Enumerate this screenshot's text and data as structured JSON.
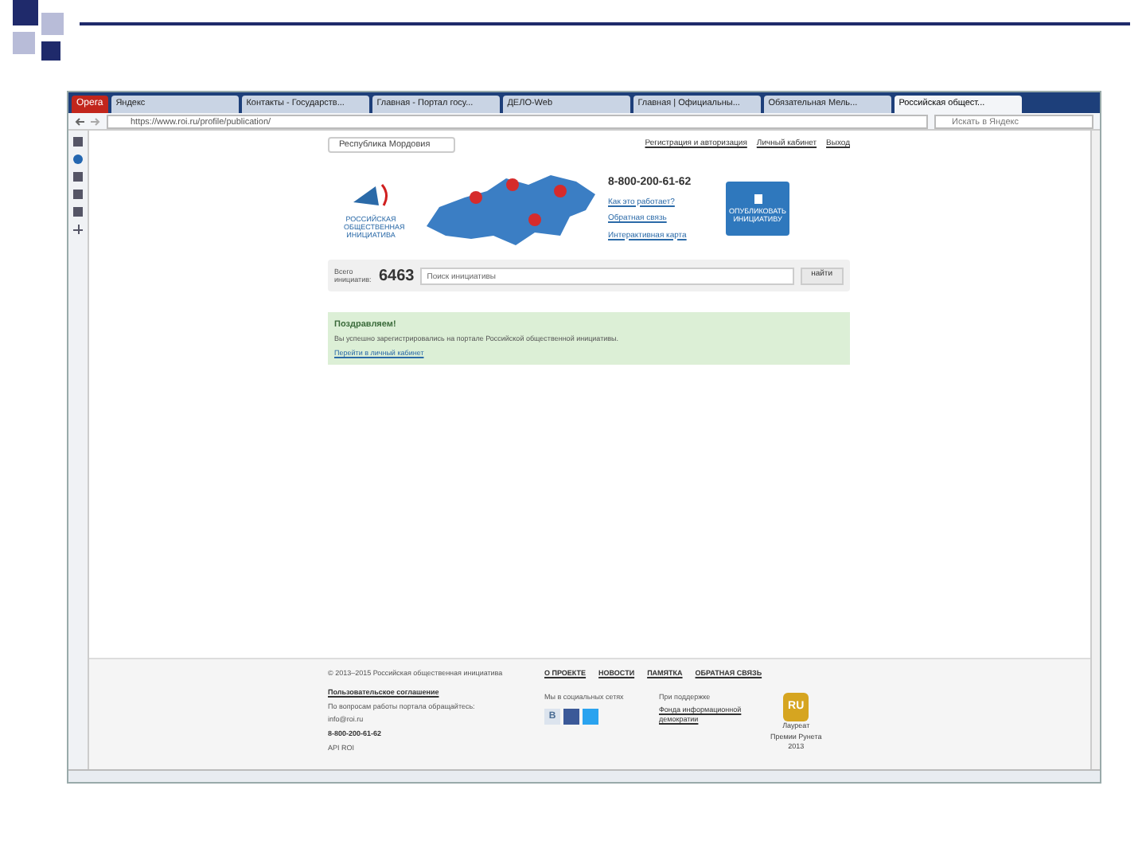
{
  "browser": {
    "menu_button": "Opera",
    "tabs": [
      {
        "label": "Яндекс",
        "selected": false
      },
      {
        "label": "Контакты - Государств...",
        "selected": false
      },
      {
        "label": "Главная - Портал госу...",
        "selected": false
      },
      {
        "label": "ДЕЛО-Web",
        "selected": false
      },
      {
        "label": "Главная | Официальны...",
        "selected": false
      },
      {
        "label": "Обязательная Мель...",
        "selected": false
      },
      {
        "label": "Российская общест...",
        "selected": true
      }
    ],
    "url": "https://www.roi.ru/profile/publication/",
    "search_placeholder": "Искать в Яндекс"
  },
  "header": {
    "region": "Республика Мордовия",
    "links": [
      "Регистрация и авторизация",
      "Личный кабинет",
      "Выход"
    ],
    "logo_text": "РОССИЙСКАЯ ОБЩЕСТВЕННАЯ ИНИЦИАТИВА",
    "phone": "8-800-200-61-62",
    "info_links": [
      "Как это работает?",
      "Обратная связь",
      "Интерактивная карта"
    ],
    "publish_button": "ОПУБЛИКОВАТЬ ИНИЦИАТИВУ"
  },
  "search": {
    "total_label": "Всего инициатив:",
    "total": "6463",
    "placeholder": "Поиск инициативы",
    "button": "найти"
  },
  "notice": {
    "title": "Поздравляем!",
    "text": "Вы успешно зарегистрировались на портале Российской общественной инициативы.",
    "link": "Перейти в личный кабинет"
  },
  "footer": {
    "copyright": "© 2013–2015 Российская общественная инициатива",
    "nav": [
      "О ПРОЕКТЕ",
      "НОВОСТИ",
      "ПАМЯТКА",
      "ОБРАТНАЯ СВЯЗЬ"
    ],
    "agreement": "Пользовательское соглашение",
    "contact_lines": [
      "По вопросам работы портала обращайтесь:",
      "info@roi.ru",
      "8-800-200-61-62",
      "API ROI"
    ],
    "social_label": "Мы в социальных сетях",
    "social": [
      "В"
    ],
    "support_label": "При поддержке",
    "support_link": "Фонда информационной демократии",
    "award_badge": "RU",
    "award_lines": [
      "Лауреат",
      "Премии Рунета",
      "2013"
    ]
  }
}
